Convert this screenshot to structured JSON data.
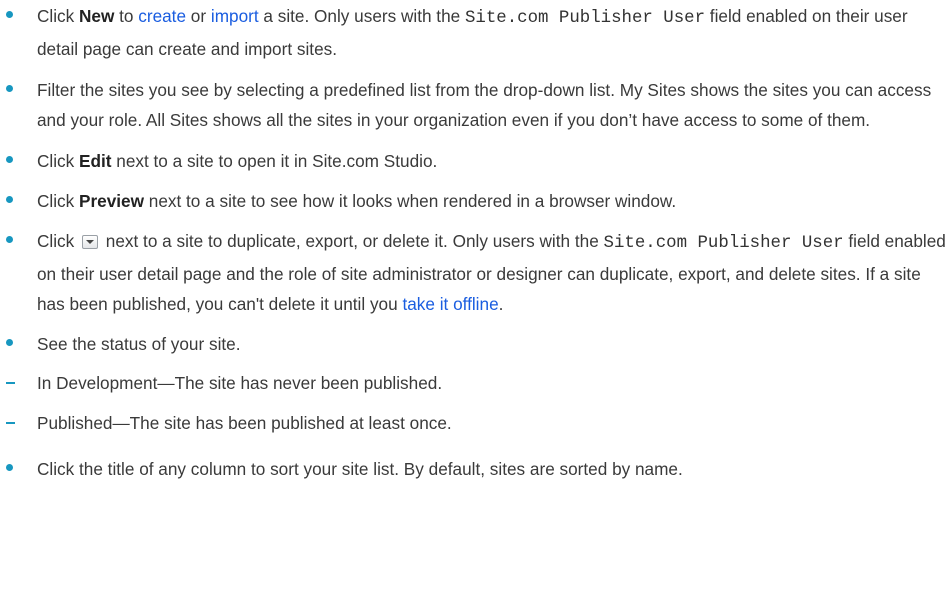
{
  "items": [
    {
      "pre": "Click ",
      "bold": "New",
      "to": " to ",
      "link_create": "create",
      "or": " or ",
      "link_import": "import",
      "mid": " a site. Only users with the ",
      "code": "Site.com Publisher User",
      "post": " field enabled on their user detail page can create and import sites."
    },
    {
      "text": "Filter the sites you see by selecting a predefined list from the drop-down list. My Sites shows the sites you can access and your role. All Sites shows all the sites in your organization even if you don’t have access to some of them."
    },
    {
      "pre": "Click ",
      "bold": "Edit",
      "post": " next to a site to open it in Site.com Studio."
    },
    {
      "pre": "Click ",
      "bold": "Preview",
      "post": " next to a site to see how it looks when rendered in a browser window."
    },
    {
      "pre": "Click ",
      "icon": "dropdown-menu-icon",
      "mid": " next to a site to duplicate, export, or delete it. Only users with the ",
      "code": "Site.com Publisher User",
      "post": " field enabled on their user detail page and the role of site administrator or designer can duplicate, export, and delete sites. If a site has been published, you can't delete it until you ",
      "link": "take it offline",
      "end": "."
    },
    {
      "text": "See the status of your site.",
      "sub": [
        "In Development—The site has never been published.",
        "Published—The site has been published at least once."
      ]
    },
    {
      "text": "Click the title of any column to sort your site list. By default, sites are sorted by name."
    }
  ],
  "colors": {
    "bullet": "#1797c0",
    "link": "#1a5de0",
    "text": "#3a3a3a"
  }
}
